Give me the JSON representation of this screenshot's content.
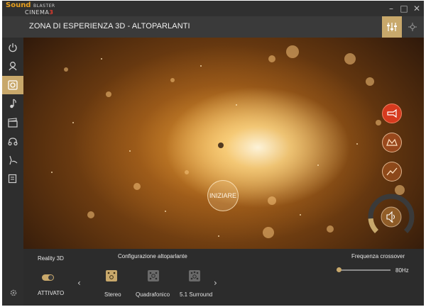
{
  "app": {
    "logo_line1": "Sound",
    "logo_blaster": "BLASTER",
    "logo_line2": "CINEMA",
    "logo_version": "3"
  },
  "header": {
    "title": "ZONA DI ESPERIENZA 3D - ALTOPARLANTI"
  },
  "window_controls": {
    "minimize": "–",
    "maximize": "□",
    "close": "✕"
  },
  "sidebar": {
    "items": [
      {
        "icon": "power-icon",
        "active": false
      },
      {
        "icon": "profile-icon",
        "active": false
      },
      {
        "icon": "speaker-icon",
        "active": true
      },
      {
        "icon": "music-note-icon",
        "active": false
      },
      {
        "icon": "clapperboard-icon",
        "active": false
      },
      {
        "icon": "headphones-icon",
        "active": false
      },
      {
        "icon": "night-mode-icon",
        "active": false
      },
      {
        "icon": "notepad-icon",
        "active": false
      }
    ]
  },
  "hero": {
    "start_label": "INIZIARE",
    "side_buttons": [
      "surround-icon",
      "crystalizer-icon",
      "bass-icon"
    ],
    "volume_level": 0.85
  },
  "bottom": {
    "reality3d_label": "Reality 3D",
    "toggle_state": "ATTIVATO",
    "speaker_config_label": "Configurazione altoparlante",
    "speaker_options": [
      "Stereo",
      "Quadrafonico",
      "5.1 Surround"
    ],
    "selected_option": "Stereo",
    "crossover_label": "Frequenza crossover",
    "crossover_value": "80Hz",
    "crossover_fraction": 0.04
  },
  "colors": {
    "accent": "#c8a86b",
    "background": "#303030",
    "active_red": "#d63a1e"
  }
}
